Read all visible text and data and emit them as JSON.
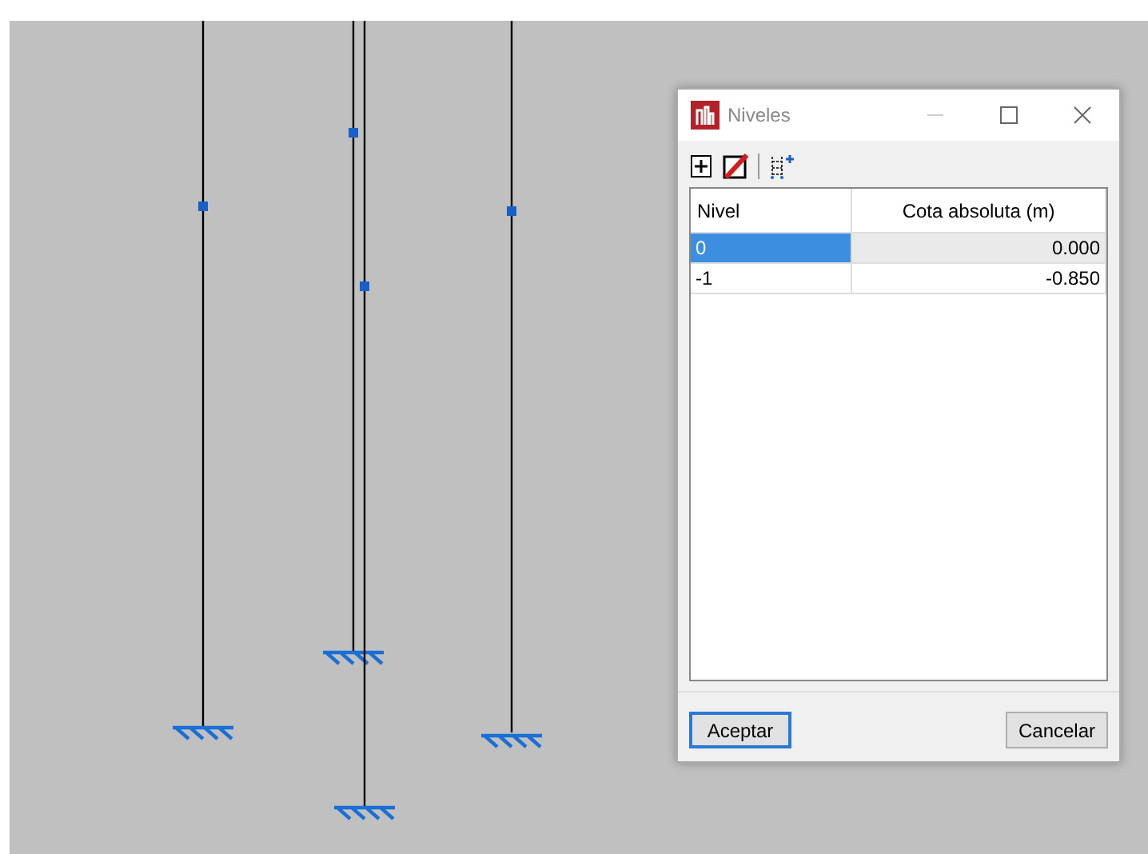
{
  "window": {
    "title": "Niveles"
  },
  "table": {
    "columns": [
      "Nivel",
      "Cota absoluta (m)"
    ],
    "rows": [
      {
        "cells": [
          "0",
          "0.000"
        ],
        "selected": true
      },
      {
        "cells": [
          "-1",
          "-0.850"
        ],
        "selected": false
      }
    ]
  },
  "buttons": [
    {
      "label": "Aceptar",
      "default": true
    },
    {
      "label": "Cancelar",
      "default": false
    }
  ]
}
